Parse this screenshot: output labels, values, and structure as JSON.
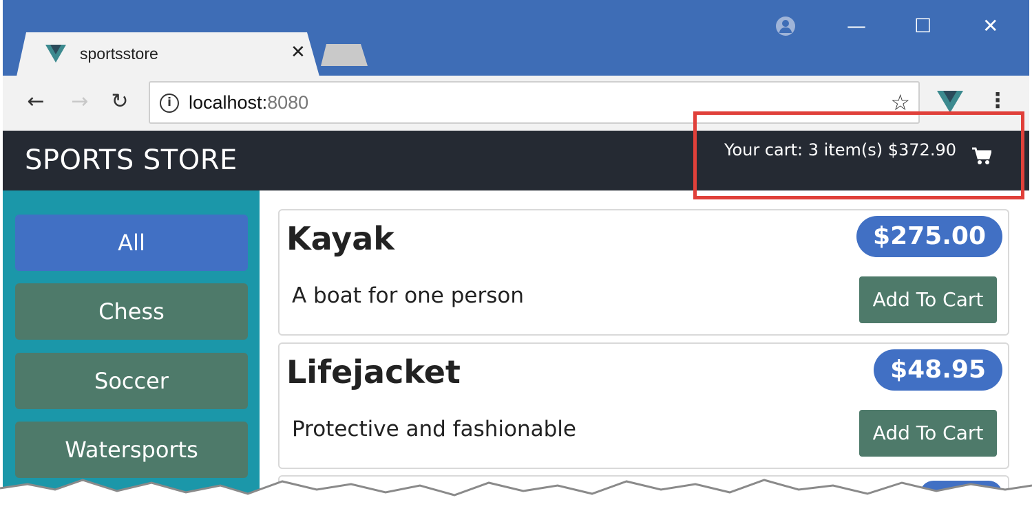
{
  "browser": {
    "tab_title": "sportsstore",
    "tab_close_glyph": "✕",
    "url_host": "localhost:",
    "url_port": "8080",
    "back_glyph": "←",
    "forward_glyph": "→",
    "reload_glyph": "↻",
    "star_glyph": "☆",
    "menu_glyph": "⋮",
    "minimize_glyph": "—",
    "maximize_glyph": "☐",
    "close_glyph": "✕",
    "icons": [
      "vue-favicon-icon",
      "account-icon",
      "info-icon",
      "star-icon",
      "vue-devtools-icon",
      "menu-icon",
      "cart-icon"
    ]
  },
  "navbar": {
    "brand": "SPORTS STORE",
    "cart_summary": "Your cart: 3 item(s) $372.90"
  },
  "categories": [
    {
      "label": "All",
      "active": true
    },
    {
      "label": "Chess",
      "active": false
    },
    {
      "label": "Soccer",
      "active": false
    },
    {
      "label": "Watersports",
      "active": false
    }
  ],
  "products": [
    {
      "name": "Kayak",
      "price": "$275.00",
      "description": "A boat for one person",
      "button": "Add To Cart"
    },
    {
      "name": "Lifejacket",
      "price": "$48.95",
      "description": "Protective and fashionable",
      "button": "Add To Cart"
    }
  ],
  "colors": {
    "titlebar": "#3e6db6",
    "navbar": "#252a33",
    "sidebar": "#1b97a9",
    "primary": "#4170c4",
    "secondary": "#4e7a6a",
    "highlight": "#e0403a"
  }
}
